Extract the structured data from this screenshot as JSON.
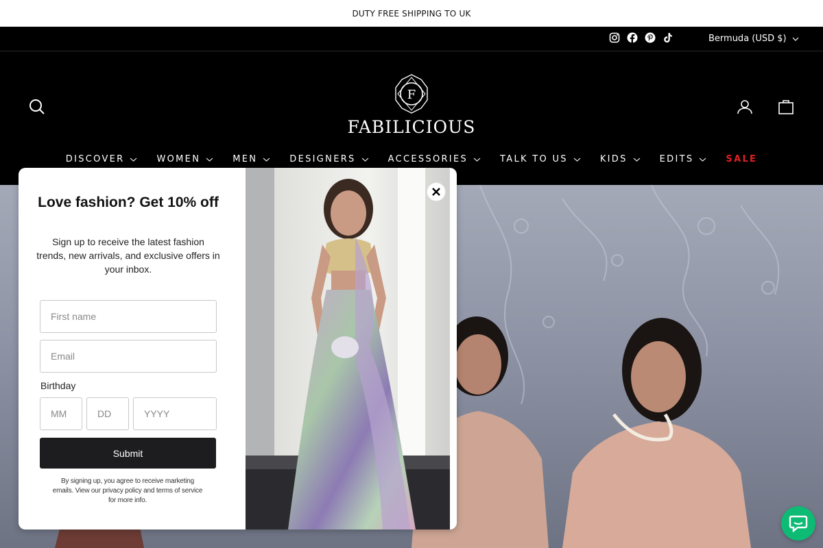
{
  "announcement": "DUTY FREE SHIPPING TO UK",
  "utility_bar": {
    "social_icons": [
      "instagram-icon",
      "facebook-icon",
      "pinterest-icon",
      "tiktok-icon"
    ],
    "currency": "Bermuda (USD $)"
  },
  "header": {
    "brand": "FABILICIOUS",
    "logo_letter": "F",
    "left_icons": [
      "search-icon"
    ],
    "right_icons": [
      "account-icon",
      "cart-icon"
    ]
  },
  "nav": [
    {
      "label": "DISCOVER",
      "dropdown": true
    },
    {
      "label": "WOMEN",
      "dropdown": true
    },
    {
      "label": "MEN",
      "dropdown": true
    },
    {
      "label": "DESIGNERS",
      "dropdown": true
    },
    {
      "label": "ACCESSORIES",
      "dropdown": true
    },
    {
      "label": "TALK TO US",
      "dropdown": true
    },
    {
      "label": "KIDS",
      "dropdown": true
    },
    {
      "label": "EDITS",
      "dropdown": true
    },
    {
      "label": "SALE",
      "dropdown": false
    }
  ],
  "popup": {
    "title": "Love fashion? Get 10% off",
    "subtitle": "Sign up to receive the latest fashion trends, new arrivals, and exclusive offers in your inbox.",
    "first_name_placeholder": "First name",
    "email_placeholder": "Email",
    "birthday_label": "Birthday",
    "month_placeholder": "MM",
    "day_placeholder": "DD",
    "year_placeholder": "YYYY",
    "submit_label": "Submit",
    "legal": "By signing up, you agree to receive marketing emails. View our privacy policy and terms of service for more info."
  },
  "colors": {
    "header_bg": "#000000",
    "sale": "#e02020",
    "submit_bg": "#1d1d1f",
    "chat_bg": "#0dbb74"
  }
}
